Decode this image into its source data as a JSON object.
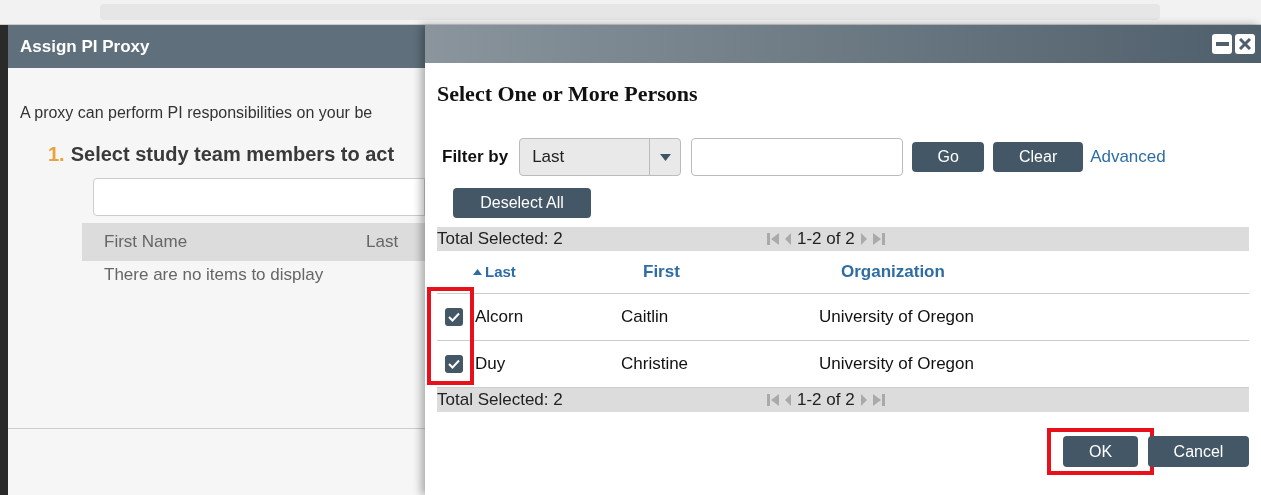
{
  "left_panel": {
    "title": "Assign PI Proxy",
    "intro": "A proxy can perform PI responsibilities on your be",
    "step": {
      "number": "1.",
      "text": "Select study team members to act"
    },
    "table": {
      "columns": [
        "First Name",
        "Last"
      ],
      "empty_message": "There are no items to display"
    }
  },
  "dialog": {
    "heading": "Select One or More Persons",
    "filter": {
      "label": "Filter by",
      "select_value": "Last",
      "buttons": [
        "Go",
        "Clear"
      ],
      "advanced_link": "Advanced"
    },
    "deselect_button": "Deselect All",
    "checkbox_column_highlighted": true,
    "pager_top": {
      "total": "Total Selected: 2",
      "range": "1-2 of 2"
    },
    "columns": [
      {
        "label": "Last",
        "sorted": true
      },
      {
        "label": "First",
        "sorted": false
      },
      {
        "label": "Organization",
        "sorted": false
      }
    ],
    "rows": [
      {
        "checked": true,
        "last": "Alcorn",
        "first": "Caitlin",
        "organization": "University of Oregon"
      },
      {
        "checked": true,
        "last": "Duy",
        "first": "Christine",
        "organization": "University of Oregon"
      }
    ],
    "pager_bottom": {
      "total": "Total Selected: 2",
      "range": "1-2 of 2"
    },
    "buttons": [
      {
        "label": "OK",
        "highlighted": true
      },
      {
        "label": "Cancel",
        "highlighted": false
      }
    ]
  }
}
